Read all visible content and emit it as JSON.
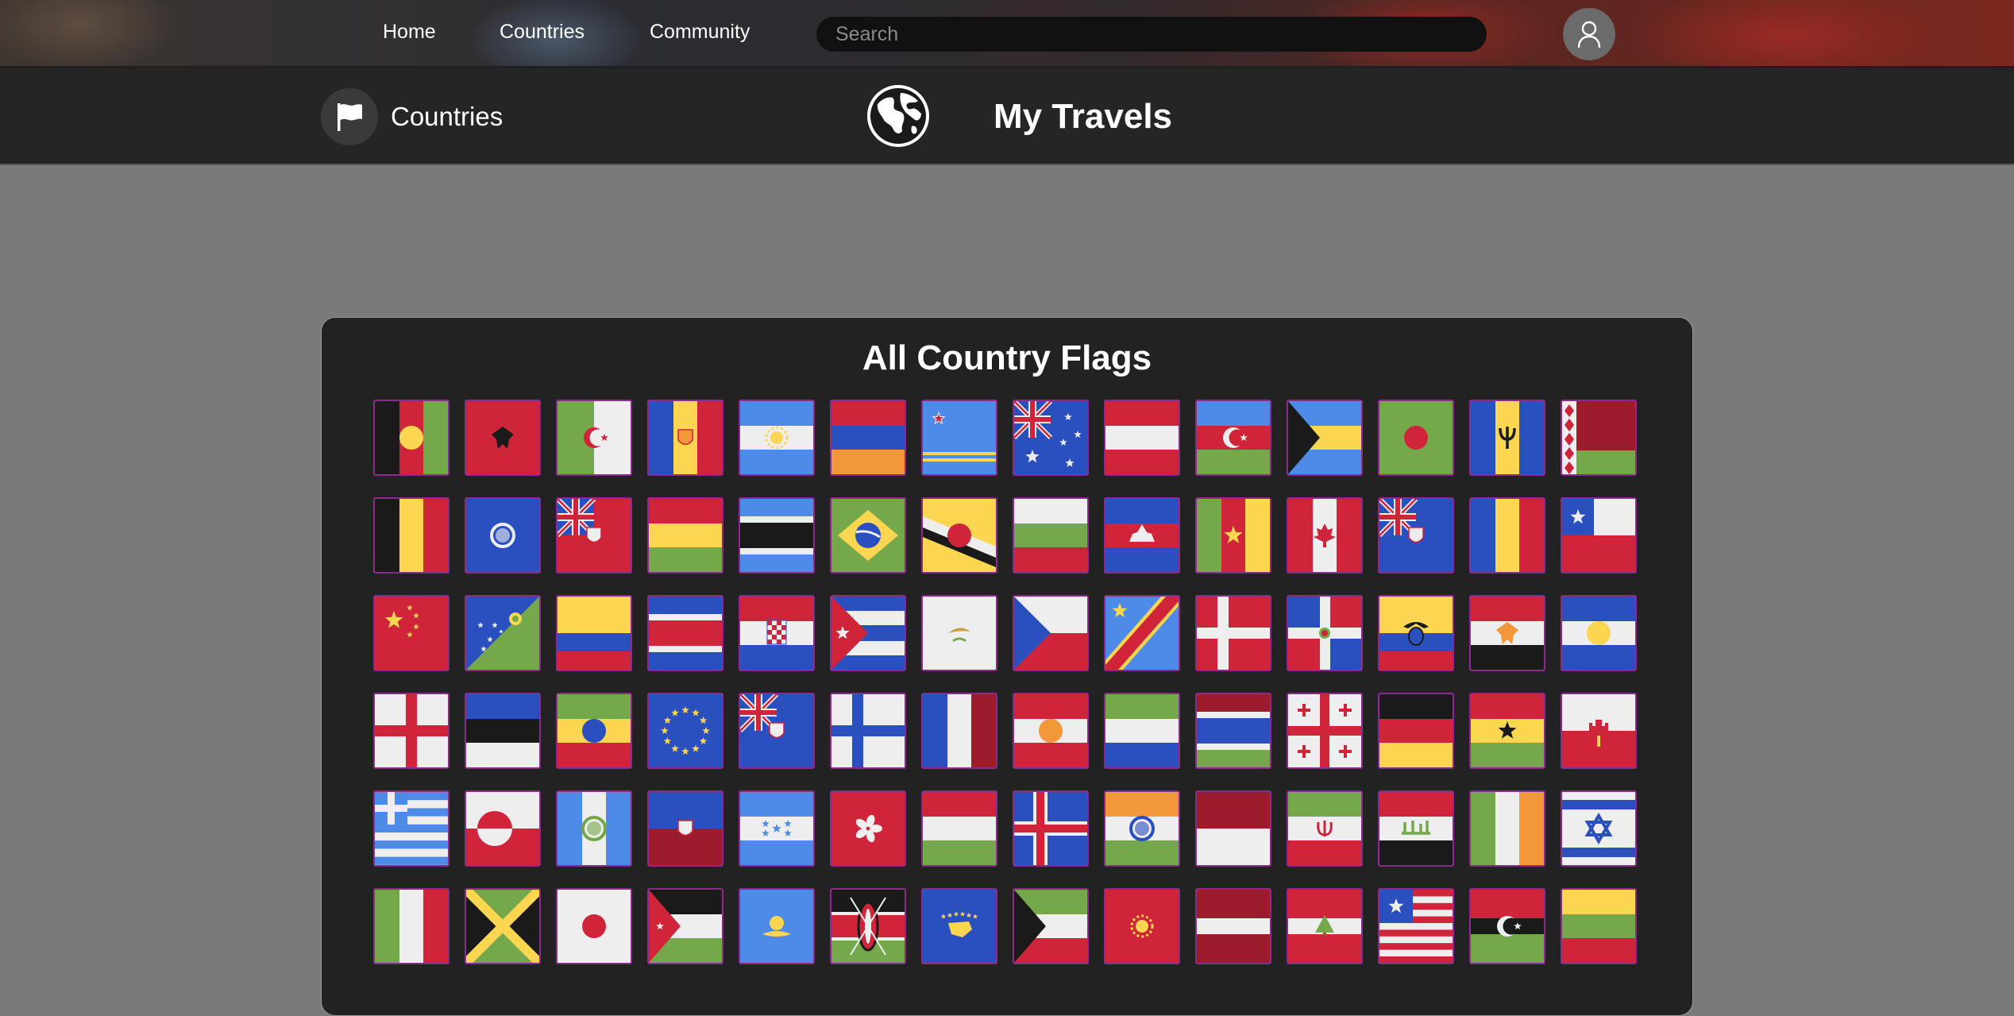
{
  "nav": {
    "links": [
      {
        "label": "Home",
        "name": "nav-home"
      },
      {
        "label": "Countries",
        "name": "nav-countries"
      },
      {
        "label": "Community",
        "name": "nav-community"
      }
    ],
    "search_placeholder": "Search",
    "user_icon": "user-icon"
  },
  "header": {
    "section_label": "Countries",
    "section_icon": "flag-icon",
    "logo_icon": "globe-icon",
    "site_title": "My Travels"
  },
  "card": {
    "title": "All Country Flags"
  },
  "colors": {
    "red": "#d0243a",
    "blue": "#2a4fbf",
    "light_blue": "#4e8ae8",
    "green": "#75a84a",
    "yellow": "#fcd651",
    "white": "#eeeeee",
    "black": "#1a1a1a",
    "maroon": "#9c1c2c",
    "orange": "#f2973a",
    "tile_border": "#8e2a8e"
  },
  "flags": [
    {
      "name": "Afghanistan",
      "type": "v3",
      "c": [
        "#1a1a1a",
        "#d0243a",
        "#75a84a"
      ],
      "emb": "circ",
      "ec": "#fcd651"
    },
    {
      "name": "Albania",
      "type": "solid",
      "c": [
        "#d0243a"
      ],
      "emb": "eagle",
      "ec": "#1a1a1a"
    },
    {
      "name": "Algeria",
      "type": "v2",
      "c": [
        "#75a84a",
        "#eeeeee"
      ],
      "emb": "crescent",
      "ec": "#d0243a"
    },
    {
      "name": "Andorra",
      "type": "v3",
      "c": [
        "#2a4fbf",
        "#fcd651",
        "#d0243a"
      ],
      "emb": "shield",
      "ec": "#f2973a"
    },
    {
      "name": "Argentina",
      "type": "h3",
      "c": [
        "#4e8ae8",
        "#eeeeee",
        "#4e8ae8"
      ],
      "emb": "sun",
      "ec": "#fcd651"
    },
    {
      "name": "Armenia",
      "type": "h3",
      "c": [
        "#d0243a",
        "#2a4fbf",
        "#f2973a"
      ]
    },
    {
      "name": "Aruba",
      "type": "aruba",
      "c": [
        "#4e8ae8"
      ]
    },
    {
      "name": "Australia",
      "type": "ukstars",
      "c": [
        "#2a4fbf"
      ]
    },
    {
      "name": "Austria",
      "type": "h3",
      "c": [
        "#d0243a",
        "#eeeeee",
        "#d0243a"
      ]
    },
    {
      "name": "Azerbaijan",
      "type": "h3",
      "c": [
        "#4e8ae8",
        "#d0243a",
        "#75a84a"
      ],
      "emb": "crescent",
      "ec": "#eeeeee"
    },
    {
      "name": "Bahamas",
      "type": "htri",
      "c": [
        "#4e8ae8",
        "#fcd651",
        "#4e8ae8",
        "#1a1a1a"
      ]
    },
    {
      "name": "Bangladesh",
      "type": "solid",
      "c": [
        "#75a84a"
      ],
      "emb": "circ",
      "ec": "#d0243a"
    },
    {
      "name": "Barbados",
      "type": "v3",
      "c": [
        "#2a4fbf",
        "#fcd651",
        "#2a4fbf"
      ],
      "emb": "trident",
      "ec": "#1a1a1a"
    },
    {
      "name": "Belarus",
      "type": "belarus",
      "c": [
        "#9c1c2c",
        "#75a84a"
      ]
    },
    {
      "name": "Belgium",
      "type": "v3",
      "c": [
        "#1a1a1a",
        "#fcd651",
        "#d0243a"
      ]
    },
    {
      "name": "Belize",
      "type": "solid",
      "c": [
        "#2a4fbf"
      ],
      "emb": "ring",
      "ec": "#eeeeee"
    },
    {
      "name": "Bermuda",
      "type": "uk",
      "c": [
        "#d0243a"
      ],
      "emb": "shield",
      "ec": "#eeeeee"
    },
    {
      "name": "Bolivia",
      "type": "h3",
      "c": [
        "#d0243a",
        "#fcd651",
        "#75a84a"
      ]
    },
    {
      "name": "Botswana",
      "type": "h5",
      "c": [
        "#4e8ae8",
        "#eeeeee",
        "#1a1a1a",
        "#eeeeee",
        "#4e8ae8"
      ]
    },
    {
      "name": "Brazil",
      "type": "brazil",
      "c": [
        "#75a84a",
        "#fcd651",
        "#2a4fbf"
      ]
    },
    {
      "name": "Brunei",
      "type": "brunei",
      "c": [
        "#fcd651",
        "#1a1a1a",
        "#eeeeee"
      ],
      "emb": "circ",
      "ec": "#d0243a"
    },
    {
      "name": "Bulgaria",
      "type": "h3",
      "c": [
        "#eeeeee",
        "#75a84a",
        "#d0243a"
      ]
    },
    {
      "name": "Cambodia",
      "type": "h3",
      "c": [
        "#2a4fbf",
        "#d0243a",
        "#2a4fbf"
      ],
      "emb": "temple",
      "ec": "#eeeeee"
    },
    {
      "name": "Cameroon",
      "type": "v3",
      "c": [
        "#75a84a",
        "#d0243a",
        "#fcd651"
      ],
      "emb": "star",
      "ec": "#fcd651"
    },
    {
      "name": "Canada",
      "type": "v3",
      "c": [
        "#d0243a",
        "#eeeeee",
        "#d0243a"
      ],
      "emb": "leaf",
      "ec": "#d0243a"
    },
    {
      "name": "Cayman Islands",
      "type": "uk",
      "c": [
        "#2a4fbf"
      ],
      "emb": "shield",
      "ec": "#eeeeee"
    },
    {
      "name": "Chad",
      "type": "v3",
      "c": [
        "#2a4fbf",
        "#fcd651",
        "#d0243a"
      ]
    },
    {
      "name": "Chile",
      "type": "chile",
      "c": [
        "#eeeeee",
        "#d0243a",
        "#2a4fbf"
      ]
    },
    {
      "name": "China",
      "type": "china",
      "c": [
        "#d0243a"
      ]
    },
    {
      "name": "Christmas Island",
      "type": "diag",
      "c": [
        "#2a4fbf",
        "#75a84a"
      ]
    },
    {
      "name": "Colombia",
      "type": "h3b",
      "c": [
        "#fcd651",
        "#2a4fbf",
        "#d0243a"
      ]
    },
    {
      "name": "Costa Rica",
      "type": "h5",
      "c": [
        "#2a4fbf",
        "#eeeeee",
        "#d0243a",
        "#eeeeee",
        "#2a4fbf"
      ]
    },
    {
      "name": "Croatia",
      "type": "h3",
      "c": [
        "#d0243a",
        "#eeeeee",
        "#2a4fbf"
      ],
      "emb": "checker",
      "ec": "#d0243a"
    },
    {
      "name": "Cuba",
      "type": "cuba",
      "c": [
        "#2a4fbf",
        "#eeeeee",
        "#d0243a"
      ]
    },
    {
      "name": "Cyprus",
      "type": "solid",
      "c": [
        "#eeeeee"
      ],
      "emb": "olive",
      "ec": "#c8a040"
    },
    {
      "name": "Czechia",
      "type": "czech",
      "c": [
        "#eeeeee",
        "#d0243a",
        "#2a4fbf"
      ]
    },
    {
      "name": "DR Congo",
      "type": "drc",
      "c": [
        "#4e8ae8",
        "#fcd651",
        "#d0243a"
      ]
    },
    {
      "name": "Denmark",
      "type": "nordic",
      "c": [
        "#d0243a",
        "#eeeeee"
      ]
    },
    {
      "name": "Dominican Republic",
      "type": "dom",
      "c": [
        "#2a4fbf",
        "#d0243a",
        "#eeeeee"
      ]
    },
    {
      "name": "Ecuador",
      "type": "h3b",
      "c": [
        "#fcd651",
        "#2a4fbf",
        "#d0243a"
      ],
      "emb": "condor",
      "ec": "#1a1a1a"
    },
    {
      "name": "Egypt",
      "type": "h3",
      "c": [
        "#d0243a",
        "#eeeeee",
        "#1a1a1a"
      ],
      "emb": "eagle",
      "ec": "#f2973a"
    },
    {
      "name": "El Salvador",
      "type": "h3",
      "c": [
        "#2a4fbf",
        "#eeeeee",
        "#2a4fbf"
      ],
      "emb": "circ",
      "ec": "#fcd651"
    },
    {
      "name": "England",
      "type": "cross",
      "c": [
        "#eeeeee",
        "#d0243a"
      ]
    },
    {
      "name": "Estonia",
      "type": "h3",
      "c": [
        "#2a4fbf",
        "#1a1a1a",
        "#eeeeee"
      ]
    },
    {
      "name": "Ethiopia",
      "type": "h3",
      "c": [
        "#75a84a",
        "#fcd651",
        "#d0243a"
      ],
      "emb": "circ",
      "ec": "#2a4fbf"
    },
    {
      "name": "European Union",
      "type": "eu",
      "c": [
        "#2a4fbf"
      ]
    },
    {
      "name": "Falkland Islands",
      "type": "uk",
      "c": [
        "#2a4fbf"
      ],
      "emb": "shield",
      "ec": "#eeeeee"
    },
    {
      "name": "Finland",
      "type": "nordic",
      "c": [
        "#eeeeee",
        "#2a4fbf"
      ]
    },
    {
      "name": "France",
      "type": "v3",
      "c": [
        "#2a4fbf",
        "#eeeeee",
        "#9c1c2c"
      ]
    },
    {
      "name": "French Polynesia",
      "type": "h3",
      "c": [
        "#d0243a",
        "#eeeeee",
        "#d0243a"
      ],
      "emb": "circ",
      "ec": "#f2973a"
    },
    {
      "name": "Gabon",
      "type": "h3",
      "c": [
        "#75a84a",
        "#eeeeee",
        "#2a4fbf"
      ]
    },
    {
      "name": "Gambia",
      "type": "h5",
      "c": [
        "#9c1c2c",
        "#eeeeee",
        "#2a4fbf",
        "#eeeeee",
        "#75a84a"
      ]
    },
    {
      "name": "Georgia",
      "type": "georgia",
      "c": [
        "#eeeeee",
        "#d0243a"
      ]
    },
    {
      "name": "Germany",
      "type": "h3",
      "c": [
        "#1a1a1a",
        "#d0243a",
        "#fcd651"
      ]
    },
    {
      "name": "Ghana",
      "type": "h3",
      "c": [
        "#d0243a",
        "#fcd651",
        "#75a84a"
      ],
      "emb": "star",
      "ec": "#1a1a1a"
    },
    {
      "name": "Gibraltar",
      "type": "h2",
      "c": [
        "#eeeeee",
        "#d0243a"
      ],
      "emb": "castle",
      "ec": "#d0243a"
    },
    {
      "name": "Greece",
      "type": "greece",
      "c": [
        "#4e8ae8",
        "#eeeeee"
      ]
    },
    {
      "name": "Greenland",
      "type": "greenland",
      "c": [
        "#eeeeee",
        "#d0243a"
      ]
    },
    {
      "name": "Guatemala",
      "type": "v3",
      "c": [
        "#4e8ae8",
        "#eeeeee",
        "#4e8ae8"
      ],
      "emb": "ring",
      "ec": "#75a84a"
    },
    {
      "name": "Haiti",
      "type": "h2",
      "c": [
        "#2a4fbf",
        "#9c1c2c"
      ],
      "emb": "shield",
      "ec": "#eeeeee"
    },
    {
      "name": "Honduras",
      "type": "h3",
      "c": [
        "#4e8ae8",
        "#eeeeee",
        "#4e8ae8"
      ],
      "emb": "stars5",
      "ec": "#4e8ae8"
    },
    {
      "name": "Hong Kong",
      "type": "solid",
      "c": [
        "#d0243a"
      ],
      "emb": "flower",
      "ec": "#eeeeee"
    },
    {
      "name": "Hungary",
      "type": "h3",
      "c": [
        "#d0243a",
        "#eeeeee",
        "#75a84a"
      ]
    },
    {
      "name": "Iceland",
      "type": "iceland",
      "c": [
        "#2a4fbf",
        "#eeeeee",
        "#d0243a"
      ]
    },
    {
      "name": "India",
      "type": "h3",
      "c": [
        "#f2973a",
        "#eeeeee",
        "#75a84a"
      ],
      "emb": "ring",
      "ec": "#2a4fbf"
    },
    {
      "name": "Indonesia",
      "type": "h2",
      "c": [
        "#9c1c2c",
        "#eeeeee"
      ]
    },
    {
      "name": "Iran",
      "type": "h3",
      "c": [
        "#75a84a",
        "#eeeeee",
        "#d0243a"
      ],
      "emb": "tulip",
      "ec": "#d0243a"
    },
    {
      "name": "Iraq",
      "type": "h3",
      "c": [
        "#d0243a",
        "#eeeeee",
        "#1a1a1a"
      ],
      "emb": "script",
      "ec": "#75a84a"
    },
    {
      "name": "Ireland",
      "type": "v3",
      "c": [
        "#75a84a",
        "#eeeeee",
        "#f2973a"
      ]
    },
    {
      "name": "Israel",
      "type": "israel",
      "c": [
        "#eeeeee",
        "#2a4fbf"
      ]
    },
    {
      "name": "Italy",
      "type": "v3",
      "c": [
        "#75a84a",
        "#eeeeee",
        "#d0243a"
      ]
    },
    {
      "name": "Jamaica",
      "type": "jamaica",
      "c": [
        "#75a84a",
        "#fcd651",
        "#1a1a1a"
      ]
    },
    {
      "name": "Japan",
      "type": "solid",
      "c": [
        "#eeeeee"
      ],
      "emb": "circ",
      "ec": "#d0243a"
    },
    {
      "name": "Jordan",
      "type": "htri",
      "c": [
        "#1a1a1a",
        "#eeeeee",
        "#75a84a",
        "#d0243a"
      ]
    },
    {
      "name": "Kazakhstan",
      "type": "solid",
      "c": [
        "#4e8ae8"
      ],
      "emb": "sunbird",
      "ec": "#fcd651"
    },
    {
      "name": "Kenya",
      "type": "kenya",
      "c": [
        "#1a1a1a",
        "#d0243a",
        "#75a84a"
      ]
    },
    {
      "name": "Kosovo",
      "type": "solid",
      "c": [
        "#2a4fbf"
      ],
      "emb": "kosovo",
      "ec": "#fcd651"
    },
    {
      "name": "Kuwait",
      "type": "htri",
      "c": [
        "#75a84a",
        "#eeeeee",
        "#d0243a",
        "#1a1a1a"
      ]
    },
    {
      "name": "Kyrgyzstan",
      "type": "solid",
      "c": [
        "#d0243a"
      ],
      "emb": "sun",
      "ec": "#fcd651"
    },
    {
      "name": "Latvia",
      "type": "h3l",
      "c": [
        "#9c1c2c",
        "#eeeeee",
        "#9c1c2c"
      ]
    },
    {
      "name": "Lebanon",
      "type": "h3l",
      "c": [
        "#d0243a",
        "#eeeeee",
        "#d0243a"
      ],
      "emb": "tree",
      "ec": "#75a84a"
    },
    {
      "name": "Liberia",
      "type": "liberia",
      "c": [
        "#d0243a",
        "#eeeeee",
        "#2a4fbf"
      ]
    },
    {
      "name": "Libya",
      "type": "h3l",
      "c": [
        "#d0243a",
        "#1a1a1a",
        "#75a84a"
      ],
      "emb": "crescent",
      "ec": "#eeeeee"
    },
    {
      "name": "Lithuania",
      "type": "h3",
      "c": [
        "#fcd651",
        "#75a84a",
        "#d0243a"
      ]
    }
  ]
}
